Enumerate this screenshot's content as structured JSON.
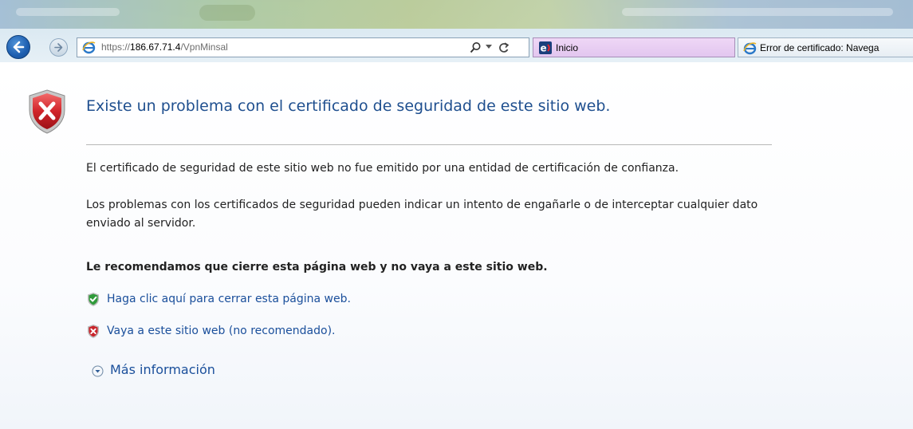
{
  "browser": {
    "address_bar": {
      "url_prefix": "https://",
      "url_host": "186.67.71.4",
      "url_path": "/VpnMinsal"
    },
    "tabs": [
      {
        "label": "Inicio",
        "active": true
      },
      {
        "label": "Error de certificado: Navega",
        "active": false
      }
    ]
  },
  "page": {
    "title": "Existe un problema con el certificado de seguridad de este sitio web.",
    "paragraph_1": "El certificado de seguridad de este sitio web no fue emitido por una entidad de certificación de confianza.",
    "paragraph_2": "Los problemas con los certificados de seguridad pueden indicar un intento de engañarle o de interceptar cualquier dato enviado al servidor.",
    "recommendation": "Le recomendamos que cierre esta página web y no vaya a este sitio web.",
    "close_link": "Haga clic aquí para cerrar esta página web.",
    "continue_link": "Vaya a este sitio web (no recomendado).",
    "more_info": "Más información"
  },
  "colors": {
    "title": "#1f4f8f",
    "link": "#1a4f9b",
    "shield_red": "#c9242b",
    "shield_green": "#2f9a3a",
    "active_tab": "#e2c6ef"
  },
  "icons": {
    "back": "back-arrow-icon",
    "forward": "forward-arrow-icon",
    "page_icon": "ie-icon",
    "search": "search-icon",
    "refresh": "refresh-icon",
    "warning": "red-shield-x-icon",
    "safe": "green-shield-check-icon",
    "expand": "chevron-down-circle-icon"
  }
}
